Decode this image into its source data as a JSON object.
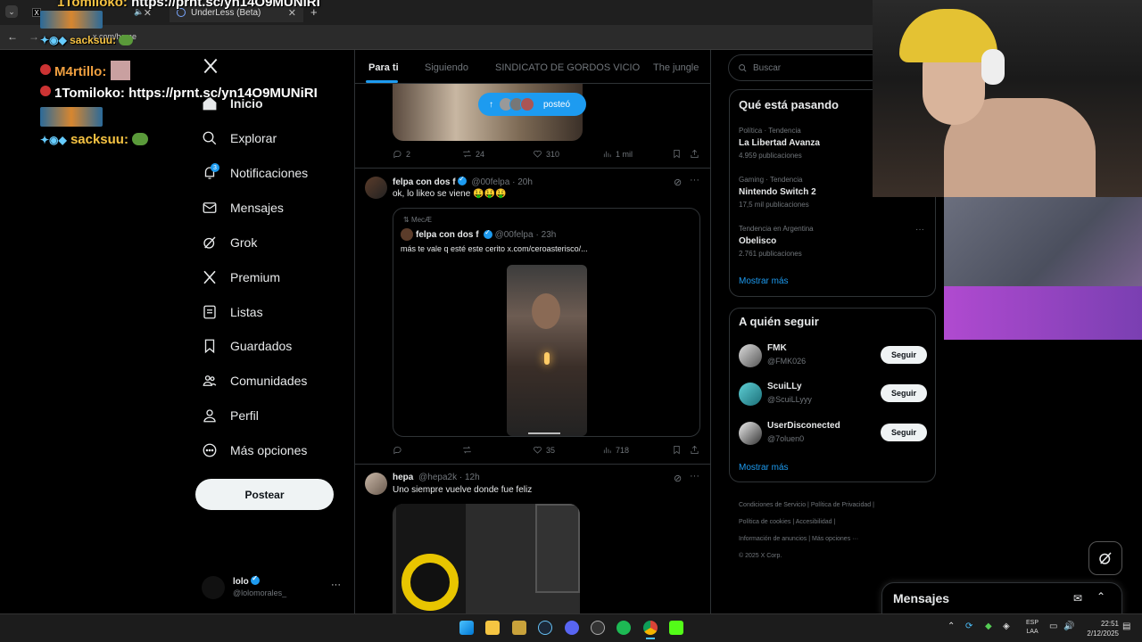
{
  "browser": {
    "tabs": [
      {
        "title": "X",
        "close": "✕"
      },
      {
        "title": "UnderLess (Beta)",
        "close": "✕"
      }
    ],
    "new_tab": "+",
    "url": "x.com/home"
  },
  "chat": [
    {
      "user": "1Tomiloko:",
      "text": "https://prnt.sc/yn14O9MUNiRI"
    },
    {
      "user": "M4rtillo:",
      "text": ""
    },
    {
      "user": "1Tomiloko:",
      "text": "https://prnt.sc/yn14O9MUNiRI"
    },
    {
      "user": "sacksuu:",
      "text": ""
    }
  ],
  "nav": {
    "items": [
      {
        "label": "Inicio",
        "icon": "home-icon"
      },
      {
        "label": "Explorar",
        "icon": "search-icon"
      },
      {
        "label": "Notificaciones",
        "icon": "bell-icon",
        "badge": "3"
      },
      {
        "label": "Mensajes",
        "icon": "mail-icon"
      },
      {
        "label": "Grok",
        "icon": "grok-icon"
      },
      {
        "label": "Premium",
        "icon": "x-logo-icon"
      },
      {
        "label": "Listas",
        "icon": "list-icon"
      },
      {
        "label": "Guardados",
        "icon": "bookmark-icon"
      },
      {
        "label": "Comunidades",
        "icon": "people-icon"
      },
      {
        "label": "Perfil",
        "icon": "person-icon"
      },
      {
        "label": "Más opciones",
        "icon": "more-circle-icon"
      }
    ],
    "post_button": "Postear",
    "account": {
      "name": "lolo",
      "handle": "@lolomorales_",
      "more": "···"
    }
  },
  "timeline": {
    "tabs": [
      "Para ti",
      "Siguiendo",
      "SINDICATO DE GORDOS VICIO",
      "The jungle"
    ],
    "new_posts_pill": "posteó",
    "post0_actions": {
      "replies": "2",
      "reposts": "24",
      "likes": "310",
      "views": "1 mil"
    },
    "post1": {
      "name": "felpa con dos f",
      "handle": "@00felpa",
      "time": "· 20h",
      "text": "ok, lo likeo se viene 🤑🤑🤑",
      "quote": {
        "context": "MecÆ",
        "name": "felpa con dos f",
        "handle": "@00felpa",
        "time": "· 23h",
        "text": "más te vale q esté este cerito  x.com/ceroasterisco/..."
      },
      "actions": {
        "replies": "",
        "reposts": "",
        "likes": "35",
        "views": "718"
      }
    },
    "post2": {
      "name": "hepa",
      "handle": "@hepa2k",
      "time": "· 12h",
      "text": "Uno siempre vuelve donde fue feliz"
    }
  },
  "right": {
    "search_placeholder": "Buscar",
    "trends_title": "Qué está pasando",
    "trends": [
      {
        "category": "Política · Tendencia",
        "name": "La Libertad Avanza",
        "count": "4.959 publicaciones"
      },
      {
        "category": "Gaming · Tendencia",
        "name": "Nintendo Switch 2",
        "count": "17,5 mil publicaciones"
      },
      {
        "category": "Tendencia en Argentina",
        "name": "Obelisco",
        "count": "2.761 publicaciones"
      }
    ],
    "show_more": "Mostrar más",
    "who_title": "A quién seguir",
    "who": [
      {
        "name": "FMK",
        "handle": "@FMK026",
        "button": "Seguir"
      },
      {
        "name": "ScuiLLy",
        "handle": "@ScuiLLyyy",
        "button": "Seguir"
      },
      {
        "name": "UserDisconected",
        "handle": "@7oluen0",
        "button": "Seguir"
      }
    ],
    "who_show_more": "Mostrar más",
    "footer": [
      "Condiciones de Servicio",
      "Política de Privacidad",
      "Política de cookies",
      "Accesibilidad",
      "Información de anuncios",
      "Más opciones ···",
      "© 2025 X Corp."
    ]
  },
  "messages_drawer": {
    "title": "Mensajes"
  },
  "taskbar": {
    "lang": "ESP",
    "lang2": "LAA",
    "time": "22:51",
    "date": "2/12/2025"
  },
  "colors": {
    "accent": "#1d9bf0",
    "border": "#2f3336",
    "muted": "#71767b"
  }
}
